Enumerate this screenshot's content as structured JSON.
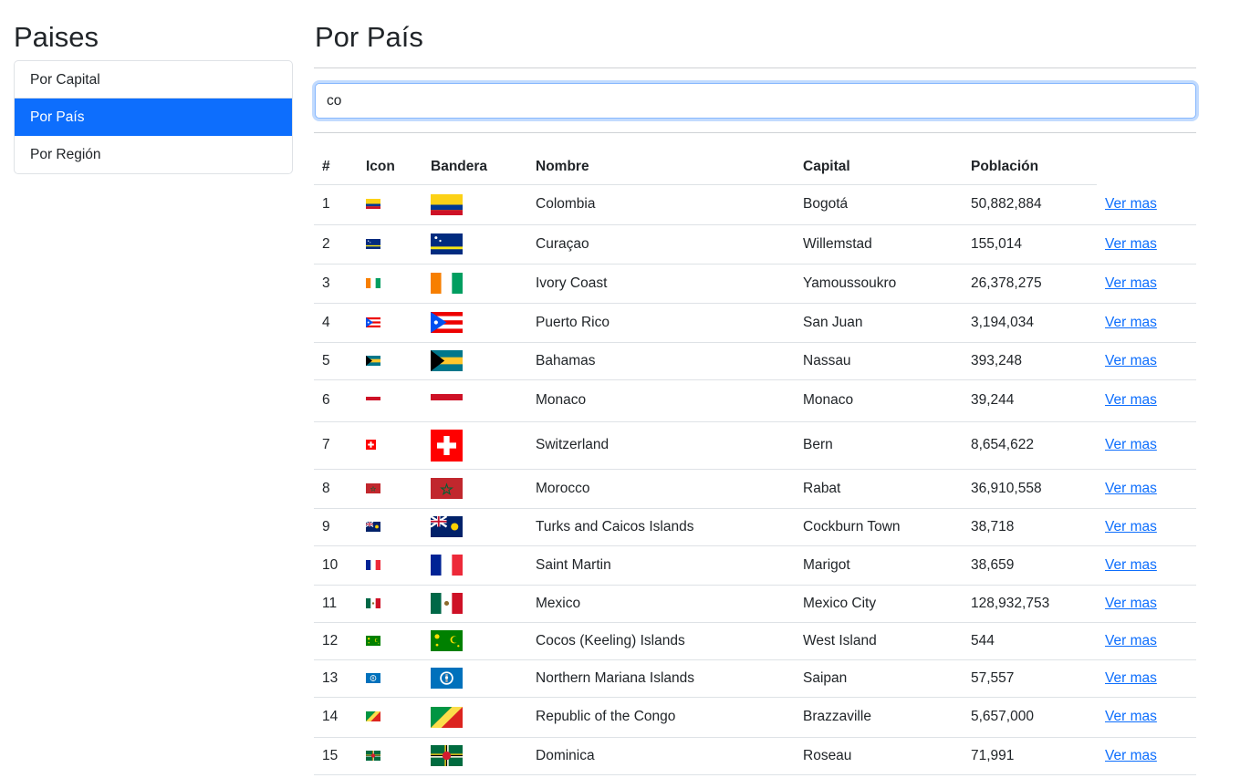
{
  "sidebar": {
    "title": "Paises",
    "items": [
      {
        "label": "Por Capital",
        "active": false
      },
      {
        "label": "Por País",
        "active": true
      },
      {
        "label": "Por Región",
        "active": false
      }
    ]
  },
  "main": {
    "title": "Por País",
    "search": {
      "value": "co"
    },
    "table": {
      "headers": [
        "#",
        "Icon",
        "Bandera",
        "Nombre",
        "Capital",
        "Población"
      ],
      "link_label": "Ver mas",
      "rows": [
        {
          "n": "1",
          "name": "Colombia",
          "capital": "Bogotá",
          "population": "50,882,884",
          "flag": "colombia"
        },
        {
          "n": "2",
          "name": "Curaçao",
          "capital": "Willemstad",
          "population": "155,014",
          "flag": "curacao"
        },
        {
          "n": "3",
          "name": "Ivory Coast",
          "capital": "Yamoussoukro",
          "population": "26,378,275",
          "flag": "ivory-coast"
        },
        {
          "n": "4",
          "name": "Puerto Rico",
          "capital": "San Juan",
          "population": "3,194,034",
          "flag": "puerto-rico"
        },
        {
          "n": "5",
          "name": "Bahamas",
          "capital": "Nassau",
          "population": "393,248",
          "flag": "bahamas"
        },
        {
          "n": "6",
          "name": "Monaco",
          "capital": "Monaco",
          "population": "39,244",
          "flag": "monaco"
        },
        {
          "n": "7",
          "name": "Switzerland",
          "capital": "Bern",
          "population": "8,654,622",
          "flag": "switzerland"
        },
        {
          "n": "8",
          "name": "Morocco",
          "capital": "Rabat",
          "population": "36,910,558",
          "flag": "morocco"
        },
        {
          "n": "9",
          "name": "Turks and Caicos Islands",
          "capital": "Cockburn Town",
          "population": "38,718",
          "flag": "turks-caicos"
        },
        {
          "n": "10",
          "name": "Saint Martin",
          "capital": "Marigot",
          "population": "38,659",
          "flag": "saint-martin"
        },
        {
          "n": "11",
          "name": "Mexico",
          "capital": "Mexico City",
          "population": "128,932,753",
          "flag": "mexico"
        },
        {
          "n": "12",
          "name": "Cocos (Keeling) Islands",
          "capital": "West Island",
          "population": "544",
          "flag": "cocos"
        },
        {
          "n": "13",
          "name": "Northern Mariana Islands",
          "capital": "Saipan",
          "population": "57,557",
          "flag": "northern-mariana"
        },
        {
          "n": "14",
          "name": "Republic of the Congo",
          "capital": "Brazzaville",
          "population": "5,657,000",
          "flag": "congo"
        },
        {
          "n": "15",
          "name": "Dominica",
          "capital": "Roseau",
          "population": "71,991",
          "flag": "dominica"
        }
      ]
    }
  }
}
